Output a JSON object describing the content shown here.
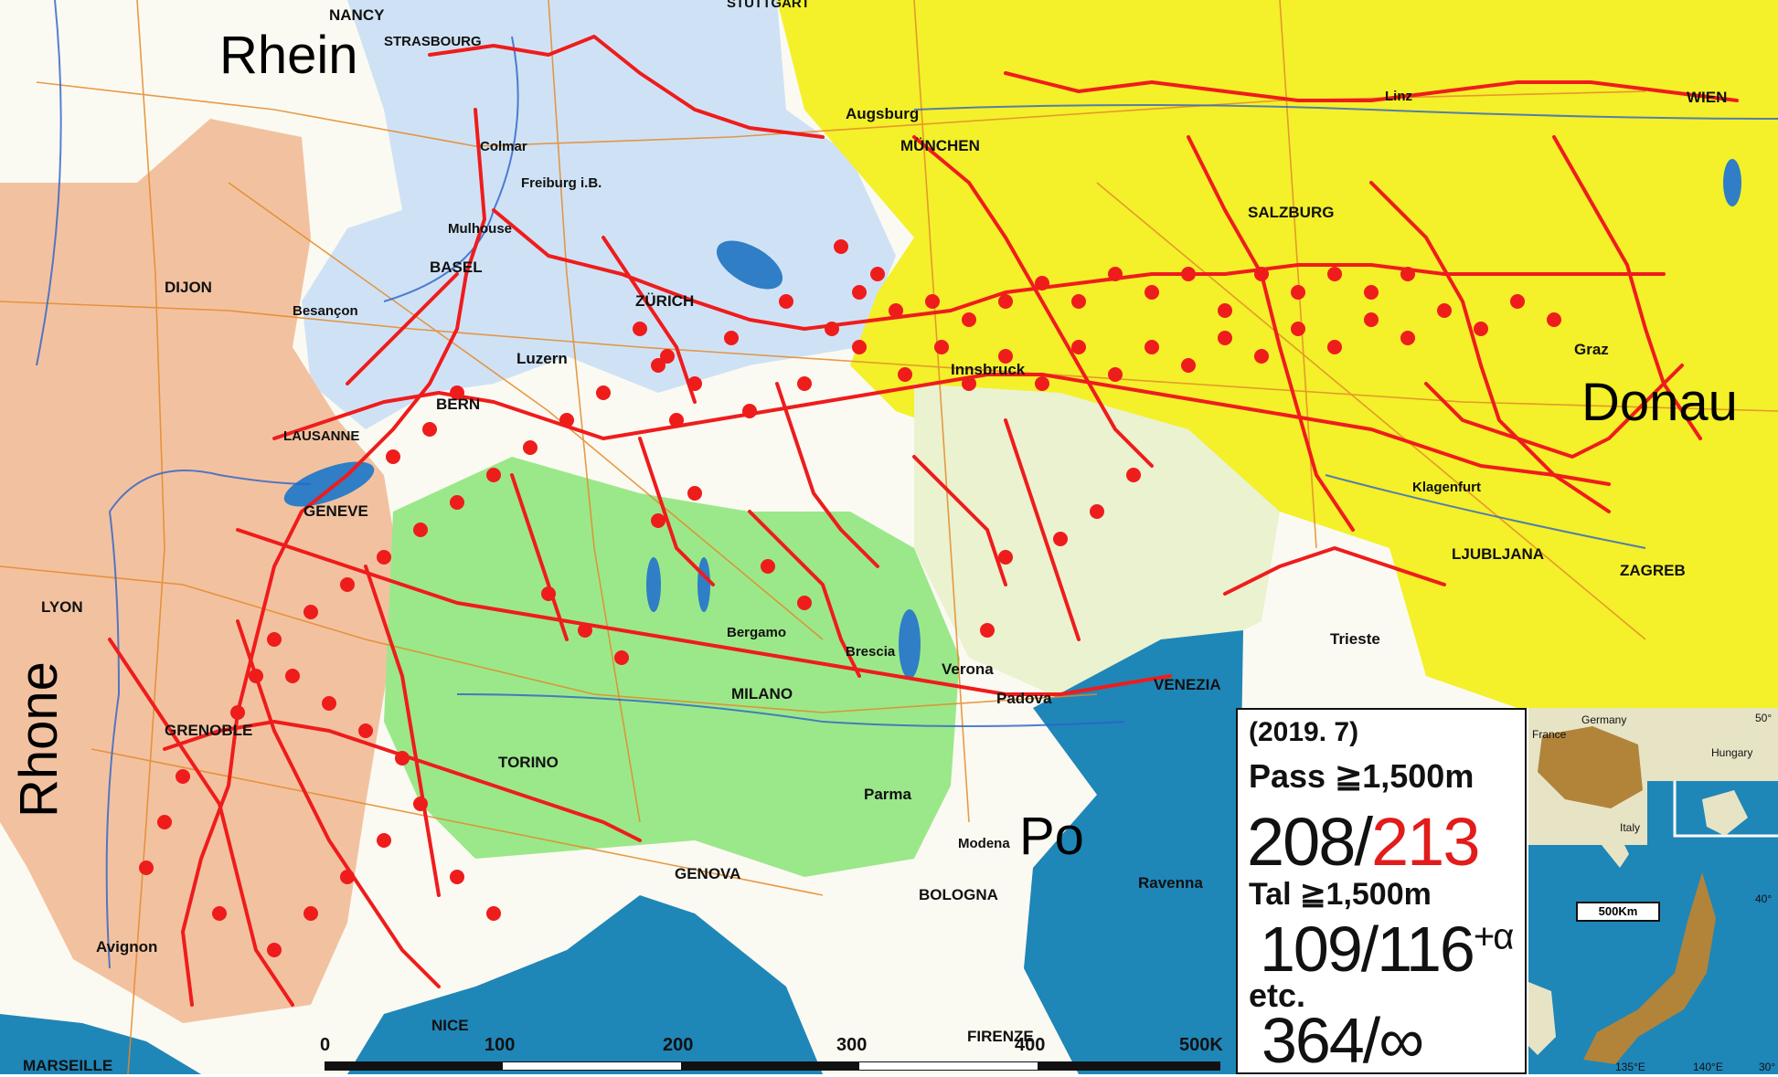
{
  "rivers": {
    "rhein": "Rhein",
    "donau": "Donau",
    "rhone": "Rhone",
    "po": "Po"
  },
  "cities": {
    "nancy": "NANCY",
    "strasbourg": "STRASBOURG",
    "stuttgart": "STUTTGART",
    "augsburg": "Augsburg",
    "muenchen": "MÜNCHEN",
    "wien": "WIEN",
    "salzburg": "SALZBURG",
    "graz": "Graz",
    "colmar": "Colmar",
    "freiburg": "Freiburg i.B.",
    "mulhouse": "Mulhouse",
    "basel": "BASEL",
    "dijon": "DIJON",
    "besancon": "Besançon",
    "zuerich": "ZÜRICH",
    "luzern": "Luzern",
    "bern": "BERN",
    "lausanne": "LAUSANNE",
    "geneve": "GENEVE",
    "lyon": "LYON",
    "grenoble": "GRENOBLE",
    "torino": "TORINO",
    "milano": "MILANO",
    "bergamo": "Bergamo",
    "brescia": "Brescia",
    "verona": "Verona",
    "padova": "Padova",
    "venezia": "VENEZIA",
    "trieste": "Trieste",
    "ljubljana": "LJUBLJANA",
    "zagreb": "ZAGREB",
    "genova": "GENOVA",
    "bologna": "BOLOGNA",
    "parma": "Parma",
    "modena": "Modena",
    "ravenna": "Ravenna",
    "firenze": "FIRENZE",
    "nice": "NICE",
    "marseille": "MARSEILLE",
    "avignon": "Avignon",
    "innsbruck": "Innsbruck",
    "klagenfurt": "Klagenfurt",
    "linz": "Linz"
  },
  "scale_bar": {
    "ticks": [
      "0",
      "100",
      "200",
      "300",
      "400",
      "500K"
    ]
  },
  "stats": {
    "date": "(2019. 7)",
    "pass_label": "Pass ≧1,500m",
    "pass_done": "208/",
    "pass_total": "213",
    "tal_label": "Tal    ≧1,500m",
    "tal_count": "109/116",
    "tal_suffix": "+α",
    "etc_label": "etc.",
    "etc_count": "364/∞"
  },
  "inset": {
    "france": "France",
    "germany": "Germany",
    "hungary": "Hungary",
    "italy": "Italy",
    "scale": "500Km",
    "lat50": "50°",
    "lat40": "40°",
    "lat30": "30°",
    "lon135": "135°E",
    "lon140": "140°E"
  },
  "colors": {
    "route": "#ef1c1c",
    "sea": "#1f86b8",
    "france_region": "#f2c2a0",
    "germany_region": "#cfe2f5",
    "austria_region": "#f4f02a",
    "italy_region": "#9be88a"
  }
}
